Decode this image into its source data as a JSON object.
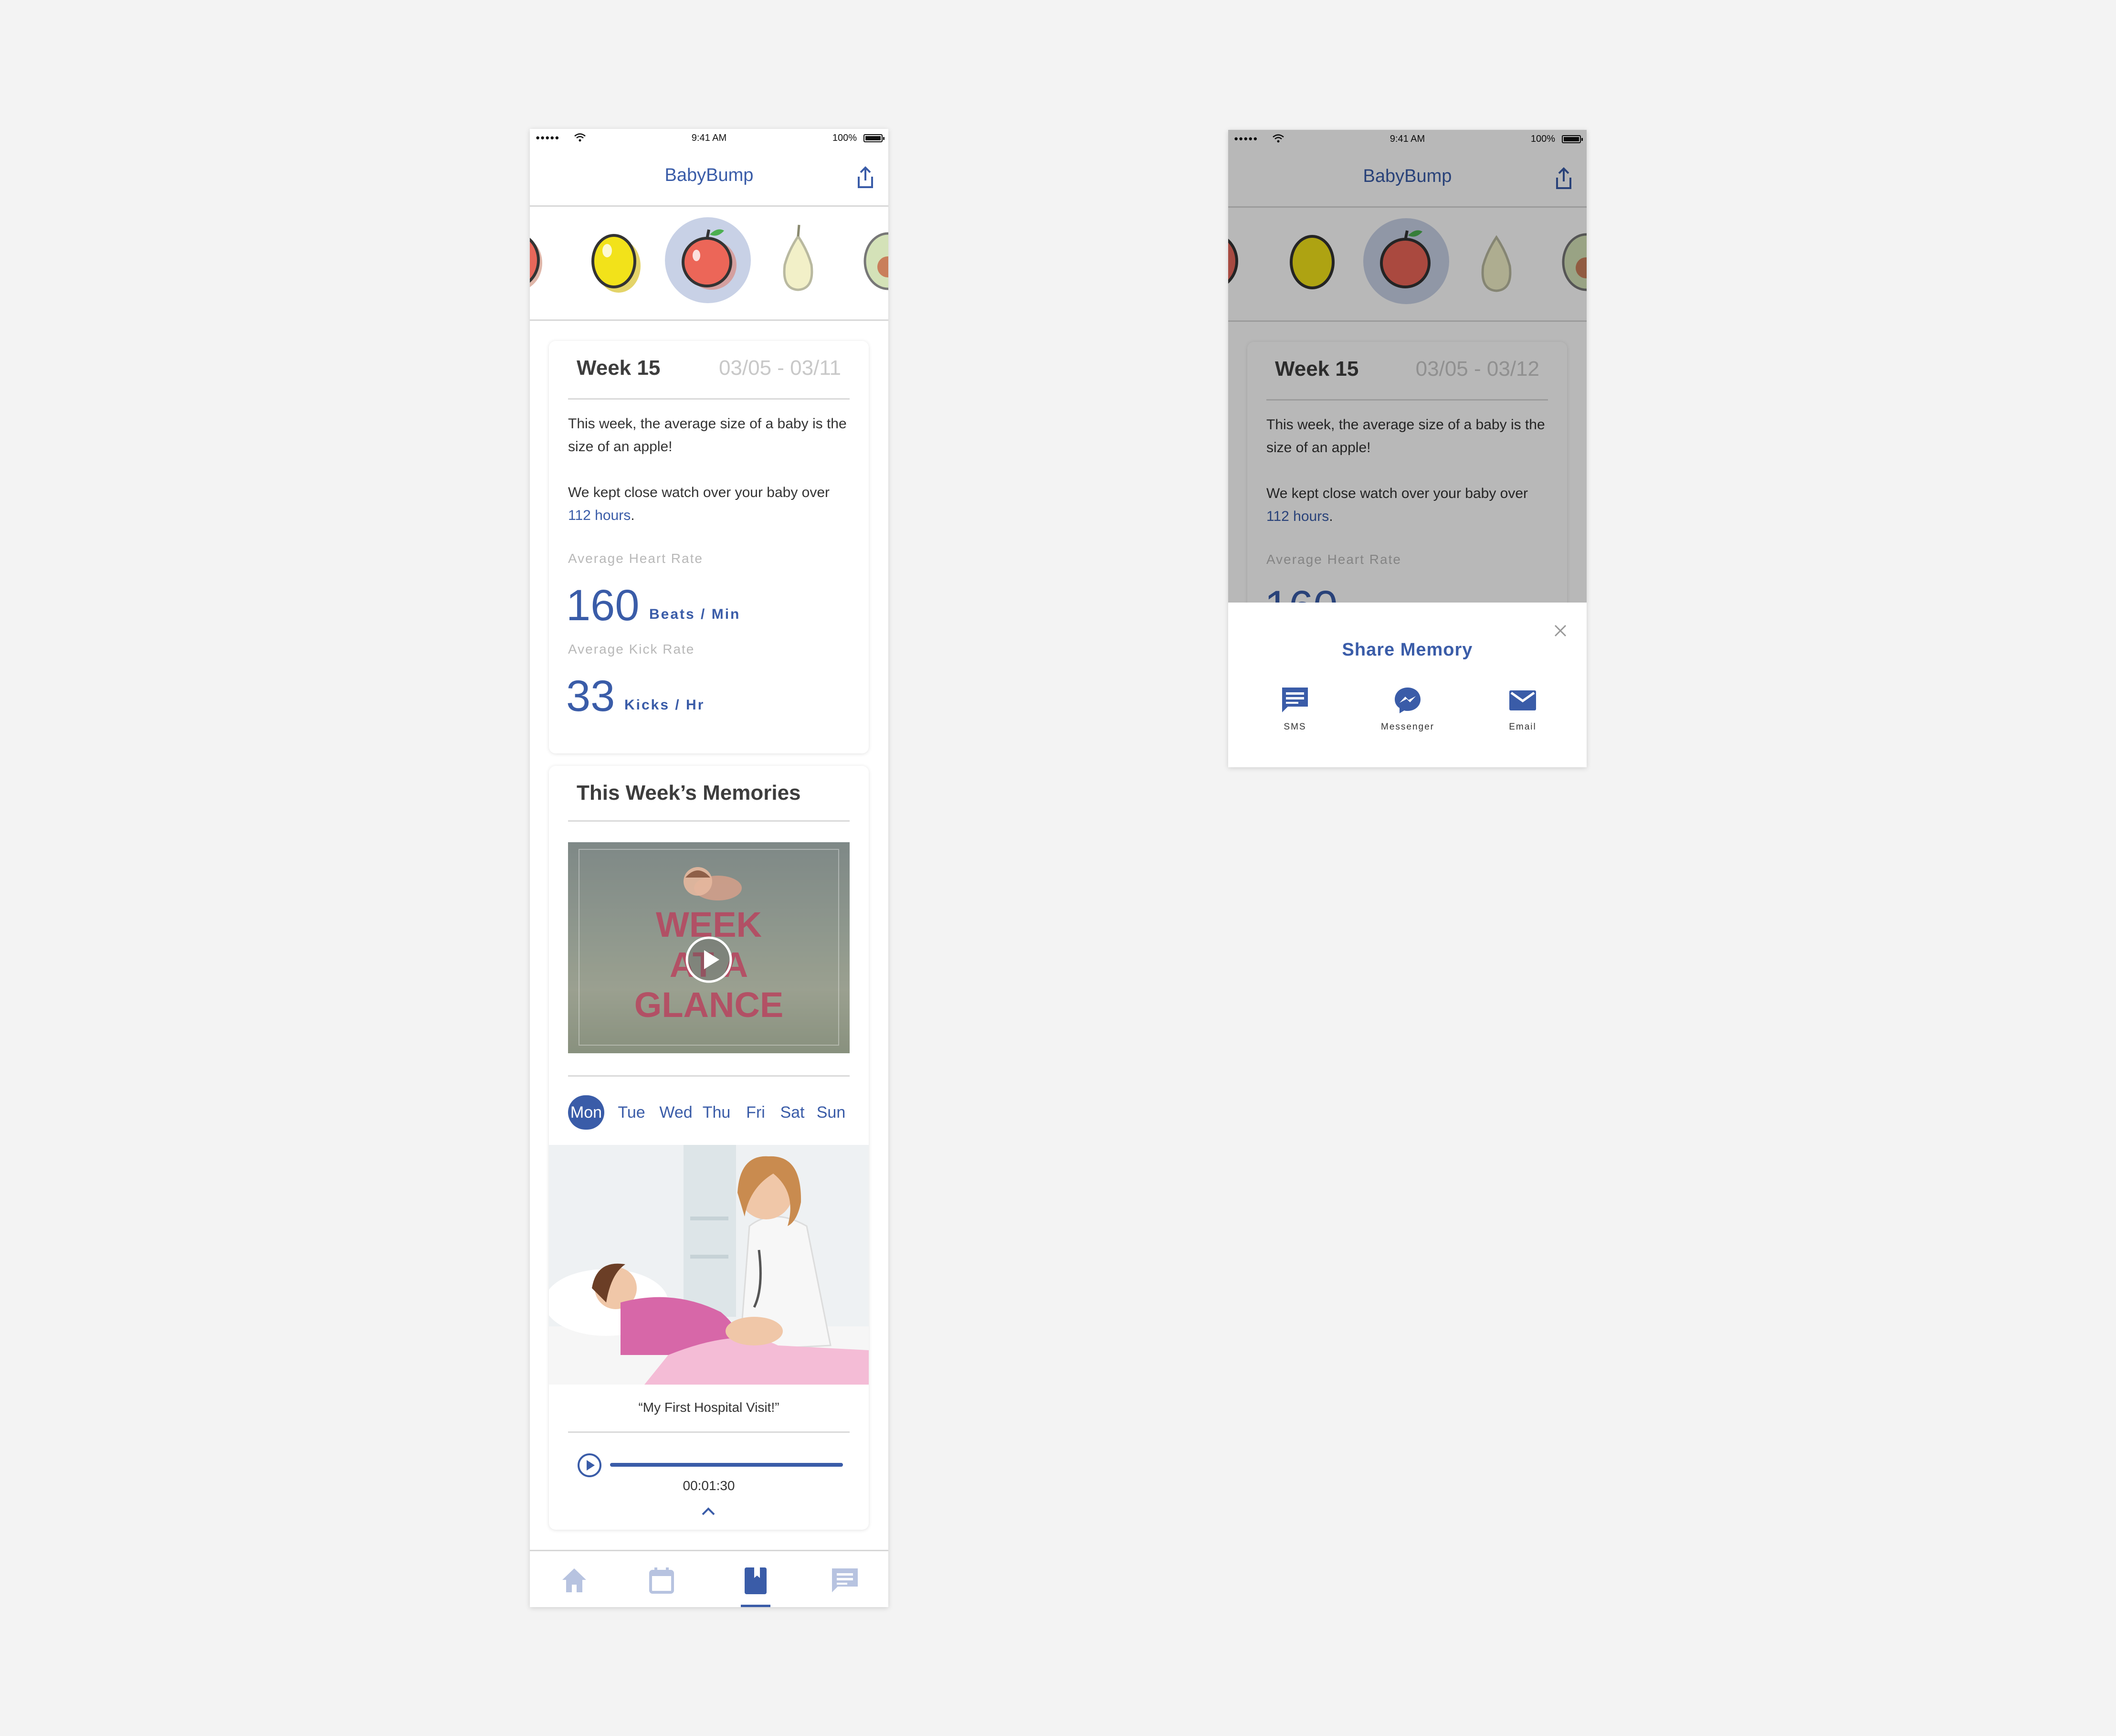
{
  "status_bar": {
    "signal": "●●●●●",
    "time": "9:41 AM",
    "battery": "100%"
  },
  "app": {
    "title": "BabyBump"
  },
  "fruits": [
    "strawberry",
    "lemon",
    "apple",
    "pear",
    "avocado"
  ],
  "week_card": {
    "week_label": "Week 15",
    "date_range": "03/05 - 03/11",
    "size_text": "This week, the average size of a baby is the size of an apple!",
    "watch_text_before": "We kept close watch over your baby over ",
    "watch_hours": "112 hours",
    "watch_text_after": ".",
    "heart_label": "Average Heart Rate",
    "heart_value": "160",
    "heart_unit": "Beats / Min",
    "kick_label": "Average Kick Rate",
    "kick_value": "33",
    "kick_unit": "Kicks / Hr"
  },
  "memories": {
    "title": "This Week’s Memories",
    "video_text": [
      "WEEK",
      "AT A",
      "GLANCE"
    ],
    "days": [
      "Mon",
      "Tue",
      "Wed",
      "Thu",
      "Fri",
      "Sat",
      "Sun"
    ],
    "selected_day": "Mon",
    "caption": "“My First Hospital Visit!”",
    "audio_time": "00:01:30",
    "audio_progress": 1.0
  },
  "tabs": [
    "home-icon",
    "calendar-icon",
    "journal-icon",
    "chat-icon"
  ],
  "active_tab": "journal-icon",
  "phone_b": {
    "date_range": "03/05 - 03/12",
    "partial_heart_value": "160"
  },
  "share_sheet": {
    "title": "Share Memory",
    "options": [
      {
        "label": "SMS",
        "icon": "sms-icon"
      },
      {
        "label": "Messenger",
        "icon": "messenger-icon"
      },
      {
        "label": "Email",
        "icon": "email-icon"
      }
    ]
  },
  "colors": {
    "accent": "#3a5ca8",
    "background": "#f3f3f3",
    "muted": "#c8c8c8"
  }
}
